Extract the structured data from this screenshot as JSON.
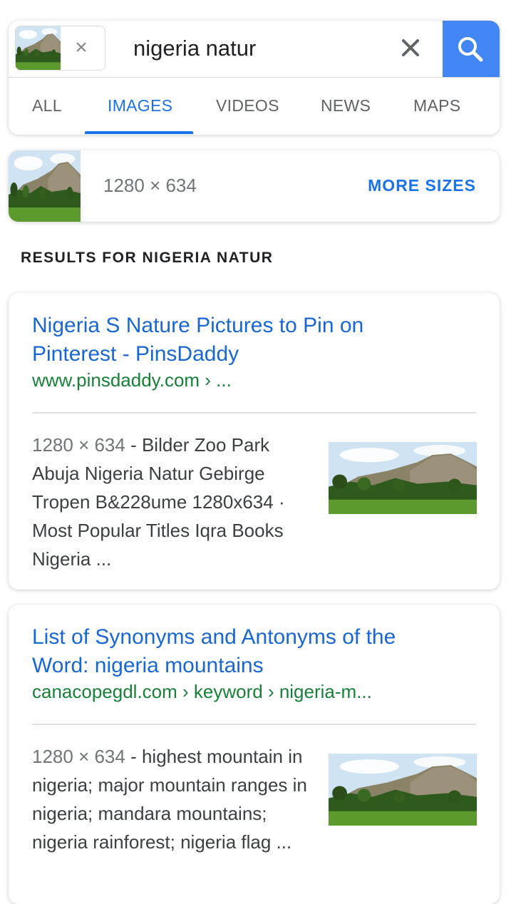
{
  "search": {
    "query": "nigeria natur",
    "chip_remove_icon": "close-icon",
    "clear_icon": "close-icon",
    "search_icon": "search-icon",
    "accent_color": "#4285f4"
  },
  "tabs": [
    {
      "label": "ALL",
      "active": false
    },
    {
      "label": "IMAGES",
      "active": true
    },
    {
      "label": "VIDEOS",
      "active": false
    },
    {
      "label": "NEWS",
      "active": false
    },
    {
      "label": "MAPS",
      "active": false
    }
  ],
  "image_info": {
    "dimensions": "1280 × 634",
    "more_sizes_label": "MORE SIZES"
  },
  "results_heading": "RESULTS FOR NIGERIA NATUR",
  "results": [
    {
      "title": "Nigeria S Nature Pictures to Pin on Pinterest - PinsDaddy",
      "url": "www.pinsdaddy.com › ...",
      "meta": "1280 × 634",
      "snippet": " - Bilder Zoo Park Abuja Nigeria Natur Gebirge Tropen B&228ume 1280x634 · Most Popular Titles Iqra Books Nigeria ..."
    },
    {
      "title": "List of Synonyms and Antonyms of the Word: nigeria mountains",
      "url": "canacopegdl.com › keyword › nigeria-m...",
      "meta": "1280 × 634",
      "snippet": " - highest mountain in nigeria; major mountain ranges in nigeria; mandara mountains; nigeria rainforest; nigeria flag ..."
    }
  ]
}
